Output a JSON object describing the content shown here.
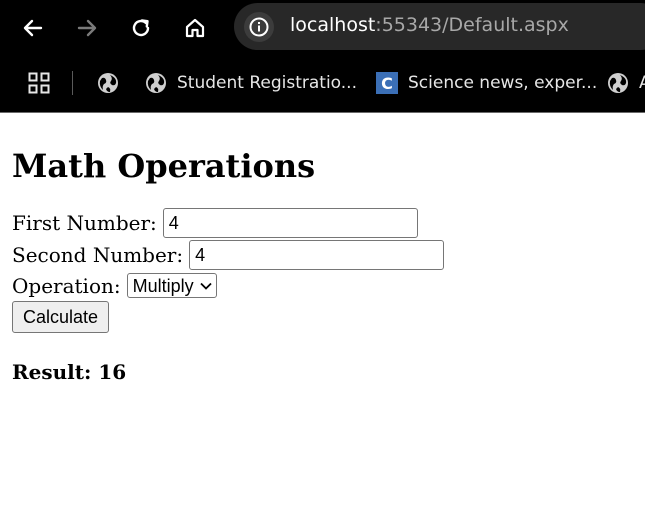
{
  "browser": {
    "url_host": "localhost",
    "url_path": ":55343/Default.aspx",
    "bookmarks": [
      {
        "icon": "globe-icon",
        "label": ""
      },
      {
        "icon": "globe-icon",
        "label": "Student Registratio..."
      },
      {
        "icon": "c-favicon-icon",
        "label": "Science news, exper..."
      },
      {
        "icon": "globe-icon",
        "label": "A"
      }
    ]
  },
  "page": {
    "title": "Math Operations",
    "first_number_label": "First Number:",
    "first_number_value": "4",
    "second_number_label": "Second Number:",
    "second_number_value": "4",
    "operation_label": "Operation:",
    "operation_selected": "Multiply",
    "calculate_label": "Calculate",
    "result_text": "Result: 16"
  }
}
